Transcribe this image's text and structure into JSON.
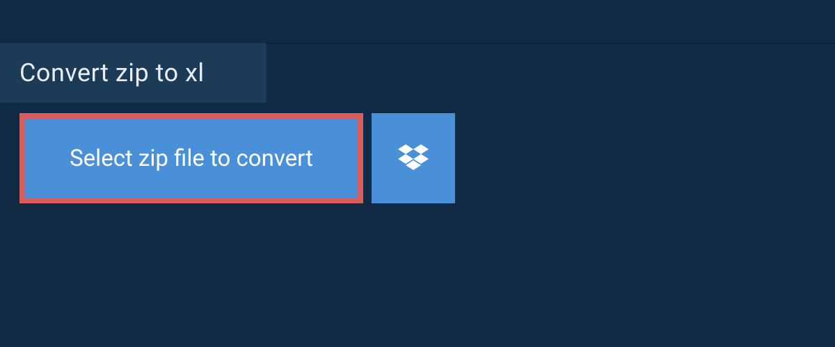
{
  "header": {
    "title": "Convert zip to xl"
  },
  "actions": {
    "select_label": "Select zip file to convert",
    "dropbox_name": "dropbox"
  },
  "colors": {
    "background": "#102a43",
    "tab_background": "#1b3b56",
    "panel_background": "#0f2a44",
    "button_background": "#4a90d9",
    "highlight_border": "#db5c5c",
    "text_light": "#ffffff"
  }
}
